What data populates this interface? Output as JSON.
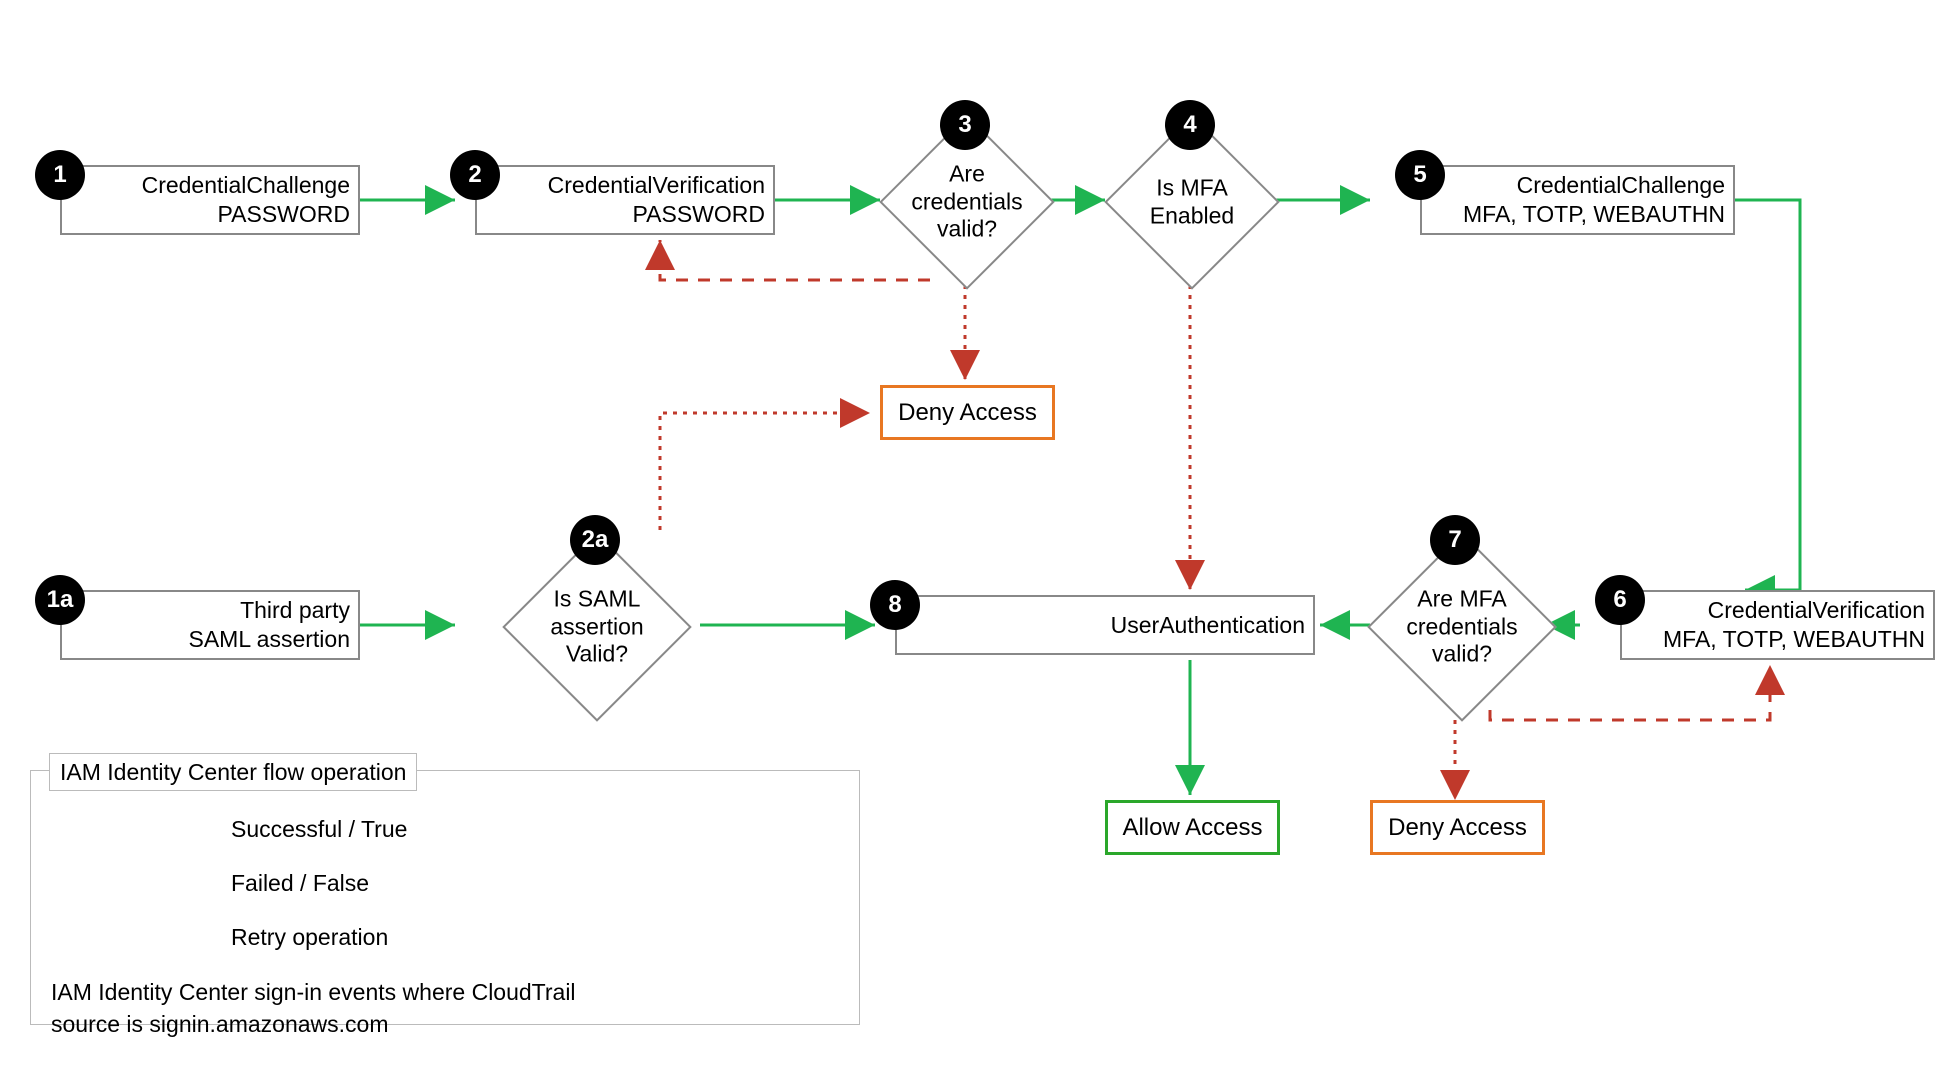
{
  "nodes": {
    "n1": {
      "badge": "1",
      "line1": "CredentialChallenge",
      "line2": "PASSWORD"
    },
    "n1a": {
      "badge": "1a",
      "line1": "Third party",
      "line2": "SAML assertion"
    },
    "n2": {
      "badge": "2",
      "line1": "CredentialVerification",
      "line2": "PASSWORD"
    },
    "n2a": {
      "badge": "2a",
      "line1": "Is SAML",
      "line2": "assertion",
      "line3": "Valid?"
    },
    "n3": {
      "badge": "3",
      "line1": "Are",
      "line2": "credentials",
      "line3": "valid?"
    },
    "n4": {
      "badge": "4",
      "line1": "Is MFA",
      "line2": "Enabled"
    },
    "n5": {
      "badge": "5",
      "line1": "CredentialChallenge",
      "line2": "MFA, TOTP, WEBAUTHN"
    },
    "n6": {
      "badge": "6",
      "line1": "CredentialVerification",
      "line2": "MFA, TOTP, WEBAUTHN"
    },
    "n7": {
      "badge": "7",
      "line1": "Are MFA",
      "line2": "credentials",
      "line3": "valid?"
    },
    "n8": {
      "badge": "8",
      "line1": "UserAuthentication"
    }
  },
  "terminals": {
    "deny1": "Deny Access",
    "deny2": "Deny Access",
    "allow": "Allow Access"
  },
  "legend": {
    "title": "IAM Identity Center flow operation",
    "success": "Successful / True",
    "failed": "Failed / False",
    "retry": "Retry operation",
    "caption1": "IAM Identity Center sign-in events where CloudTrail",
    "caption2": "source is signin.amazonaws.com"
  },
  "colors": {
    "success": "#1fb451",
    "fail": "#c0392b",
    "deny_border": "#e87722",
    "allow_border": "#2aa72a"
  }
}
